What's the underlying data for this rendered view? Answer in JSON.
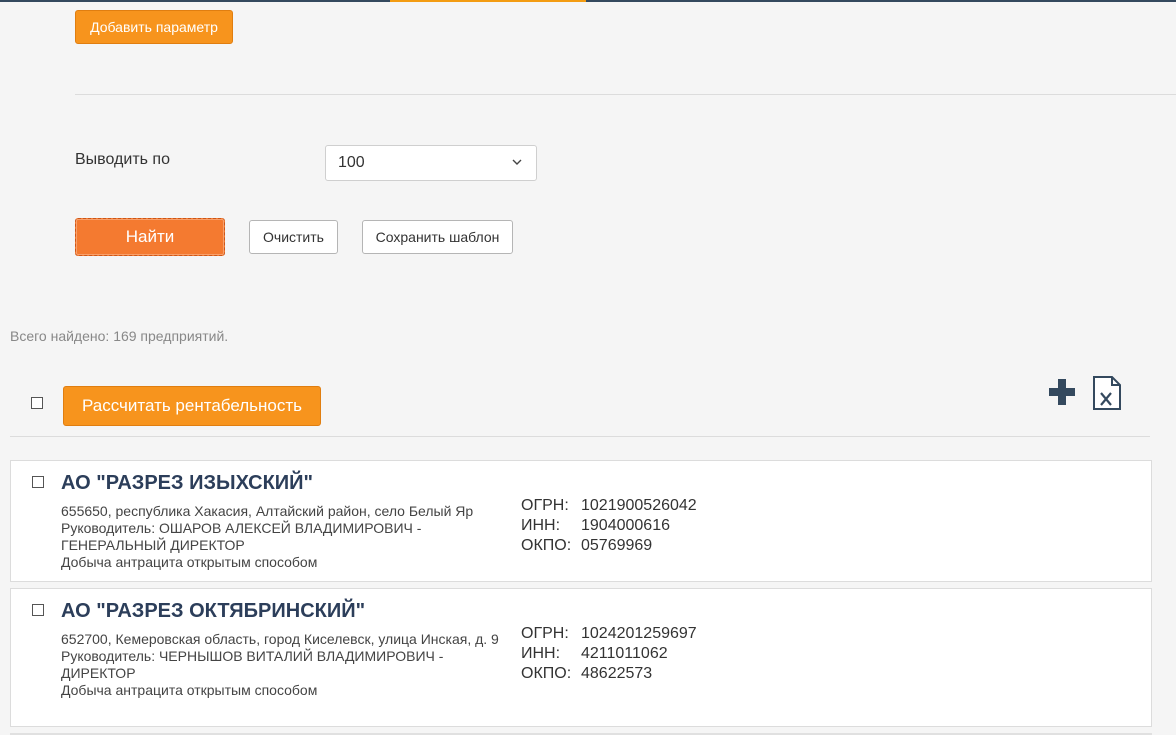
{
  "colors": {
    "accent_orange": "#f7941d",
    "find_orange": "#f47a30",
    "title_navy": "#2c3e5a",
    "icon_navy": "#34495e"
  },
  "filters": {
    "add_param_label": "Добавить параметр",
    "show_label": "Выводить по",
    "show_value": "100"
  },
  "actions": {
    "find_label": "Найти",
    "clear_label": "Очистить",
    "save_template_label": "Сохранить шаблон"
  },
  "results": {
    "total_text": "Всего найдено: 169 предприятий.",
    "calc_label": "Рассчитать рентабельность",
    "icons": [
      "plus-icon",
      "excel-export-icon"
    ],
    "items": [
      {
        "title": "АО \"РАЗРЕЗ ИЗЫХСКИЙ\"",
        "address": "655650, республика Хакасия, Алтайский район, село Белый Яр",
        "head": "Руководитель: ОШАРОВ АЛЕКСЕЙ ВЛАДИМИРОВИЧ - ГЕНЕРАЛЬНЫЙ ДИРЕКТОР",
        "activity": "Добыча антрацита открытым способом",
        "ogrn_label": "ОГРН:",
        "ogrn": "1021900526042",
        "inn_label": "ИНН:",
        "inn": "1904000616",
        "okpo_label": "ОКПО:",
        "okpo": "05769969"
      },
      {
        "title": "АО \"РАЗРЕЗ ОКТЯБРИНСКИЙ\"",
        "address": "652700, Кемеровская область, город Киселевск, улица Инская, д. 9",
        "head": "Руководитель: ЧЕРНЫШОВ ВИТАЛИЙ ВЛАДИМИРОВИЧ - ДИРЕКТОР",
        "activity": "Добыча антрацита открытым способом",
        "ogrn_label": "ОГРН:",
        "ogrn": "1024201259697",
        "inn_label": "ИНН:",
        "inn": "4211011062",
        "okpo_label": "ОКПО:",
        "okpo": "48622573"
      }
    ]
  }
}
